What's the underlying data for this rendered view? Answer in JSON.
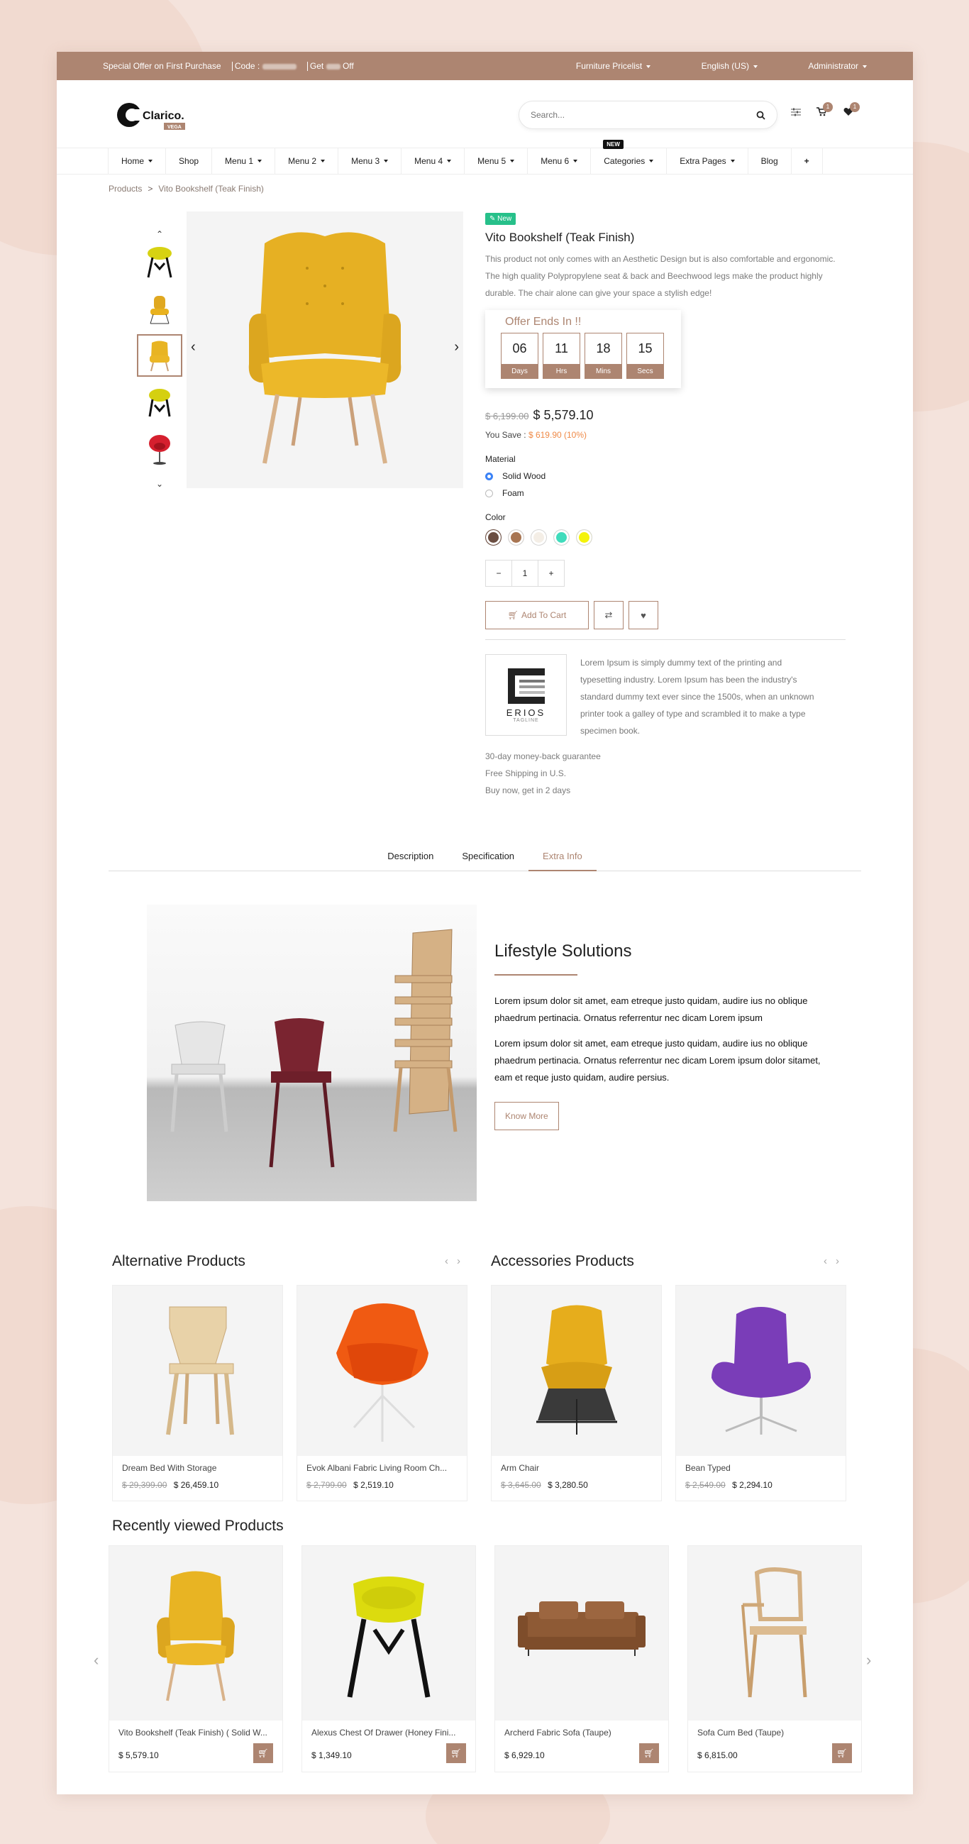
{
  "topbar": {
    "offer": "Special Offer on First Purchase",
    "code_label": "Code :",
    "get_label": "Get",
    "off_label": "Off",
    "pricelist": "Furniture Pricelist",
    "language": "English (US)",
    "user": "Administrator"
  },
  "logo": {
    "name": "Clarico.",
    "sub": "VEGA"
  },
  "search": {
    "placeholder": "Search..."
  },
  "header": {
    "cart_count": "1",
    "wishlist_count": "1"
  },
  "nav": {
    "items": [
      "Home",
      "Shop",
      "Menu 1",
      "Menu 2",
      "Menu 3",
      "Menu 4",
      "Menu 5",
      "Menu 6",
      "Categories",
      "Extra Pages",
      "Blog",
      "+"
    ],
    "new_badge": "NEW"
  },
  "breadcrumb": {
    "parent": "Products",
    "sep": ">",
    "current": "Vito Bookshelf (Teak Finish)"
  },
  "product": {
    "badge": "New",
    "title": "Vito Bookshelf (Teak Finish)",
    "description": "This product not only comes with an Aesthetic Design but is also comfortable and ergonomic. The high quality Polypropylene seat & back and Beechwood legs make the product highly durable. The chair alone can give your space a stylish edge!",
    "offer_title": "Offer Ends In !!",
    "countdown": [
      {
        "value": "06",
        "label": "Days"
      },
      {
        "value": "11",
        "label": "Hrs"
      },
      {
        "value": "18",
        "label": "Mins"
      },
      {
        "value": "15",
        "label": "Secs"
      }
    ],
    "old_price": "$ 6,199.00",
    "price": "$ 5,579.10",
    "you_save_label": "You Save :",
    "you_save": "$ 619.90 (10%)",
    "material_label": "Material",
    "materials": [
      "Solid Wood",
      "Foam"
    ],
    "selected_material": "Solid Wood",
    "color_label": "Color",
    "colors": [
      "#6b4e42",
      "#a87552",
      "#f4eee6",
      "#3fdcbc",
      "#f4f30a"
    ],
    "quantity": "1",
    "add_to_cart": "Add To Cart",
    "brand_name": "ERIOS",
    "brand_tagline": "TAGLINE",
    "brand_text": "Lorem Ipsum is simply dummy text of the printing and typesetting industry. Lorem Ipsum has been the industry's standard dummy text ever since the 1500s, when an unknown printer took a galley of type and scrambled it to make a type specimen book.",
    "perks": [
      "30-day money-back guarantee",
      "Free Shipping in U.S.",
      "Buy now, get in 2 days"
    ]
  },
  "tabs": [
    "Description",
    "Specification",
    "Extra Info"
  ],
  "active_tab": "Extra Info",
  "lifestyle": {
    "title": "Lifestyle Solutions",
    "p1": "Lorem ipsum dolor sit amet, eam etreque justo quidam, audire ius no oblique phaedrum pertinacia. Ornatus referrentur nec dicam Lorem ipsum",
    "p2": "Lorem ipsum dolor sit amet, eam etreque justo quidam, audire ius no oblique phaedrum pertinacia. Ornatus referrentur nec dicam Lorem ipsum dolor sitamet, eam et reque justo quidam, audire persius.",
    "button": "Know More"
  },
  "alternative": {
    "title": "Alternative Products",
    "items": [
      {
        "name": "Dream Bed With Storage",
        "old": "$ 29,399.00",
        "price": "$ 26,459.10"
      },
      {
        "name": "Evok Albani Fabric Living Room Ch...",
        "old": "$ 2,799.00",
        "price": "$ 2,519.10"
      }
    ]
  },
  "accessories": {
    "title": "Accessories Products",
    "items": [
      {
        "name": "Arm Chair",
        "old": "$ 3,645.00",
        "price": "$ 3,280.50"
      },
      {
        "name": "Bean Typed",
        "old": "$ 2,549.00",
        "price": "$ 2,294.10"
      }
    ]
  },
  "recent": {
    "title": "Recently viewed Products",
    "items": [
      {
        "name": "Vito Bookshelf (Teak Finish) ( Solid W...",
        "price": "$ 5,579.10"
      },
      {
        "name": "Alexus Chest Of Drawer (Honey Fini...",
        "price": "$ 1,349.10"
      },
      {
        "name": "Archerd Fabric Sofa (Taupe)",
        "price": "$ 6,929.10"
      },
      {
        "name": "Sofa Cum Bed (Taupe)",
        "price": "$ 6,815.00"
      }
    ]
  },
  "theme": {
    "accent": "#ad8571",
    "new_green": "#27c08a",
    "save_orange": "#ef8a47"
  }
}
